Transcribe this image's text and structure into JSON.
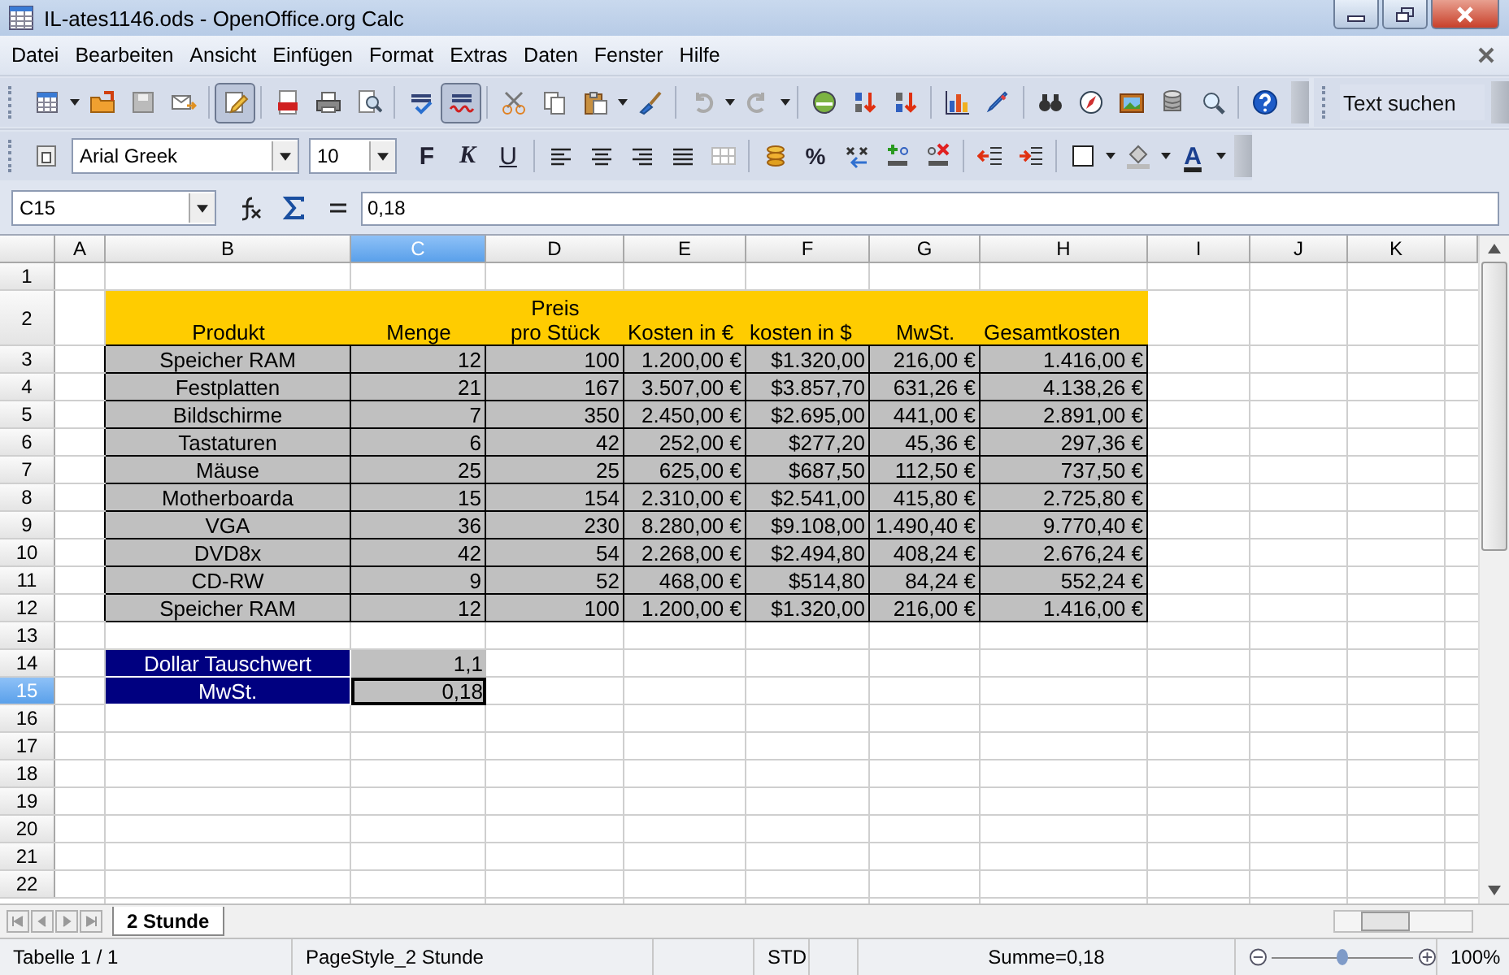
{
  "window": {
    "title": "IL-ates1146.ods - OpenOffice.org Calc"
  },
  "menu": [
    "Datei",
    "Bearbeiten",
    "Ansicht",
    "Einfügen",
    "Format",
    "Extras",
    "Daten",
    "Fenster",
    "Hilfe"
  ],
  "toolbar": {
    "edit_mode_on": true,
    "auto_spellcheck_on": true
  },
  "search": {
    "placeholder": "Text suchen"
  },
  "formatting": {
    "font_name": "Arial Greek",
    "font_size": "10",
    "bold_label": "F",
    "italic_label": "K",
    "underline_label": "U",
    "percent_label": "%",
    "font_color_label": "A"
  },
  "formula_bar": {
    "cell_reference": "C15",
    "value": "0,18"
  },
  "sheet": {
    "columns": [
      {
        "label": "A",
        "selected": false
      },
      {
        "label": "B",
        "selected": false
      },
      {
        "label": "C",
        "selected": true
      },
      {
        "label": "D",
        "selected": false
      },
      {
        "label": "E",
        "selected": false
      },
      {
        "label": "F",
        "selected": false
      },
      {
        "label": "G",
        "selected": false
      },
      {
        "label": "H",
        "selected": false
      },
      {
        "label": "I",
        "selected": false
      },
      {
        "label": "J",
        "selected": false
      },
      {
        "label": "K",
        "selected": false
      }
    ],
    "rows": [
      {
        "number": "1",
        "selected": false,
        "kind": "empty",
        "cells": []
      },
      {
        "number": "2",
        "selected": false,
        "kind": "header",
        "cells": [
          "",
          "Produkt",
          "Menge",
          "Preis\npro Stück",
          "Kosten in €",
          "kosten in $",
          "MwSt.",
          "Gesamtkosten"
        ]
      },
      {
        "number": "3",
        "selected": false,
        "kind": "data",
        "cells": [
          "",
          "Speicher RAM",
          "12",
          "100",
          "1.200,00 €",
          "$1.320,00",
          "216,00 €",
          "1.416,00 €"
        ]
      },
      {
        "number": "4",
        "selected": false,
        "kind": "data",
        "cells": [
          "",
          "Festplatten",
          "21",
          "167",
          "3.507,00 €",
          "$3.857,70",
          "631,26 €",
          "4.138,26 €"
        ]
      },
      {
        "number": "5",
        "selected": false,
        "kind": "data",
        "cells": [
          "",
          "Bildschirme",
          "7",
          "350",
          "2.450,00 €",
          "$2.695,00",
          "441,00 €",
          "2.891,00 €"
        ]
      },
      {
        "number": "6",
        "selected": false,
        "kind": "data",
        "cells": [
          "",
          "Tastaturen",
          "6",
          "42",
          "252,00 €",
          "$277,20",
          "45,36 €",
          "297,36 €"
        ]
      },
      {
        "number": "7",
        "selected": false,
        "kind": "data",
        "cells": [
          "",
          "Mäuse",
          "25",
          "25",
          "625,00 €",
          "$687,50",
          "112,50 €",
          "737,50 €"
        ]
      },
      {
        "number": "8",
        "selected": false,
        "kind": "data",
        "cells": [
          "",
          "Motherboarda",
          "15",
          "154",
          "2.310,00 €",
          "$2.541,00",
          "415,80 €",
          "2.725,80 €"
        ]
      },
      {
        "number": "9",
        "selected": false,
        "kind": "data",
        "cells": [
          "",
          "VGA",
          "36",
          "230",
          "8.280,00 €",
          "$9.108,00",
          "1.490,40 €",
          "9.770,40 €"
        ]
      },
      {
        "number": "10",
        "selected": false,
        "kind": "data",
        "cells": [
          "",
          "DVD8x",
          "42",
          "54",
          "2.268,00 €",
          "$2.494,80",
          "408,24 €",
          "2.676,24 €"
        ]
      },
      {
        "number": "11",
        "selected": false,
        "kind": "data",
        "cells": [
          "",
          "CD-RW",
          "9",
          "52",
          "468,00 €",
          "$514,80",
          "84,24 €",
          "552,24 €"
        ]
      },
      {
        "number": "12",
        "selected": false,
        "kind": "data",
        "cells": [
          "",
          "Speicher RAM",
          "12",
          "100",
          "1.200,00 €",
          "$1.320,00",
          "216,00 €",
          "1.416,00 €"
        ]
      },
      {
        "number": "13",
        "selected": false,
        "kind": "empty",
        "cells": []
      },
      {
        "number": "14",
        "selected": false,
        "kind": "param",
        "cells": [
          "",
          "Dollar Tauschwert",
          "1,1"
        ]
      },
      {
        "number": "15",
        "selected": true,
        "kind": "param",
        "cells": [
          "",
          "MwSt.",
          "0,18"
        ]
      },
      {
        "number": "16",
        "selected": false,
        "kind": "empty",
        "cells": []
      },
      {
        "number": "17",
        "selected": false,
        "kind": "empty",
        "cells": []
      },
      {
        "number": "18",
        "selected": false,
        "kind": "empty",
        "cells": []
      },
      {
        "number": "19",
        "selected": false,
        "kind": "empty",
        "cells": []
      },
      {
        "number": "20",
        "selected": false,
        "kind": "empty",
        "cells": []
      },
      {
        "number": "21",
        "selected": false,
        "kind": "empty",
        "cells": []
      },
      {
        "number": "22",
        "selected": false,
        "kind": "empty",
        "cells": []
      }
    ]
  },
  "sheet_tabs": [
    {
      "label": "2 Stunde",
      "selected": true
    }
  ],
  "status_bar": {
    "sheet": "Tabelle 1 / 1",
    "page_style": "PageStyle_2 Stunde",
    "mode": "STD",
    "sum": "Summe=0,18",
    "zoom_slider": {
      "level": 0.5
    },
    "zoom": "100%"
  }
}
